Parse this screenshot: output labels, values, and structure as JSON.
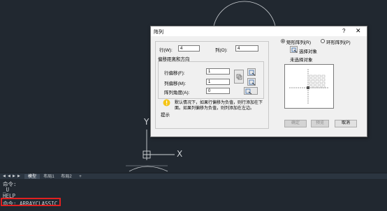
{
  "dialog": {
    "title": "阵列",
    "help_glyph": "?",
    "close_glyph": "✕",
    "rows_label": "行(W):",
    "rows_value": "4",
    "cols_label": "列(O):",
    "cols_value": "4",
    "offset_group_title": "偏移距离和方向",
    "row_offset_label": "行偏移(F):",
    "row_offset_value": "1",
    "col_offset_label": "列偏移(M):",
    "col_offset_value": "1",
    "angle_label": "阵列角度(A):",
    "angle_value": "0",
    "tip_text_line1": "默认情况下，如果行偏移为负值，则行添加在下",
    "tip_text_line2": "面。如果列偏移为负值，则列添加在左边。",
    "tip_label": "提示",
    "radio_rect": "矩形阵列(R)",
    "radio_polar": "环形阵列(P)",
    "select_objects": "选择对象",
    "no_selection": "未选择对象",
    "ok": "确定",
    "preview": "预览",
    "cancel": "取消"
  },
  "ucs": {
    "x_label": "X",
    "y_label": "Y"
  },
  "tabs": [
    "模型",
    "布局1",
    "布局2",
    "+"
  ],
  "command_lines": [
    "命令:",
    "_U",
    "HELP",
    "命令: ARRAYCLASSIC"
  ],
  "colors": {
    "workspace": "#212830",
    "highlight": "#e02020",
    "dialog_bg": "#f0f0f0"
  }
}
